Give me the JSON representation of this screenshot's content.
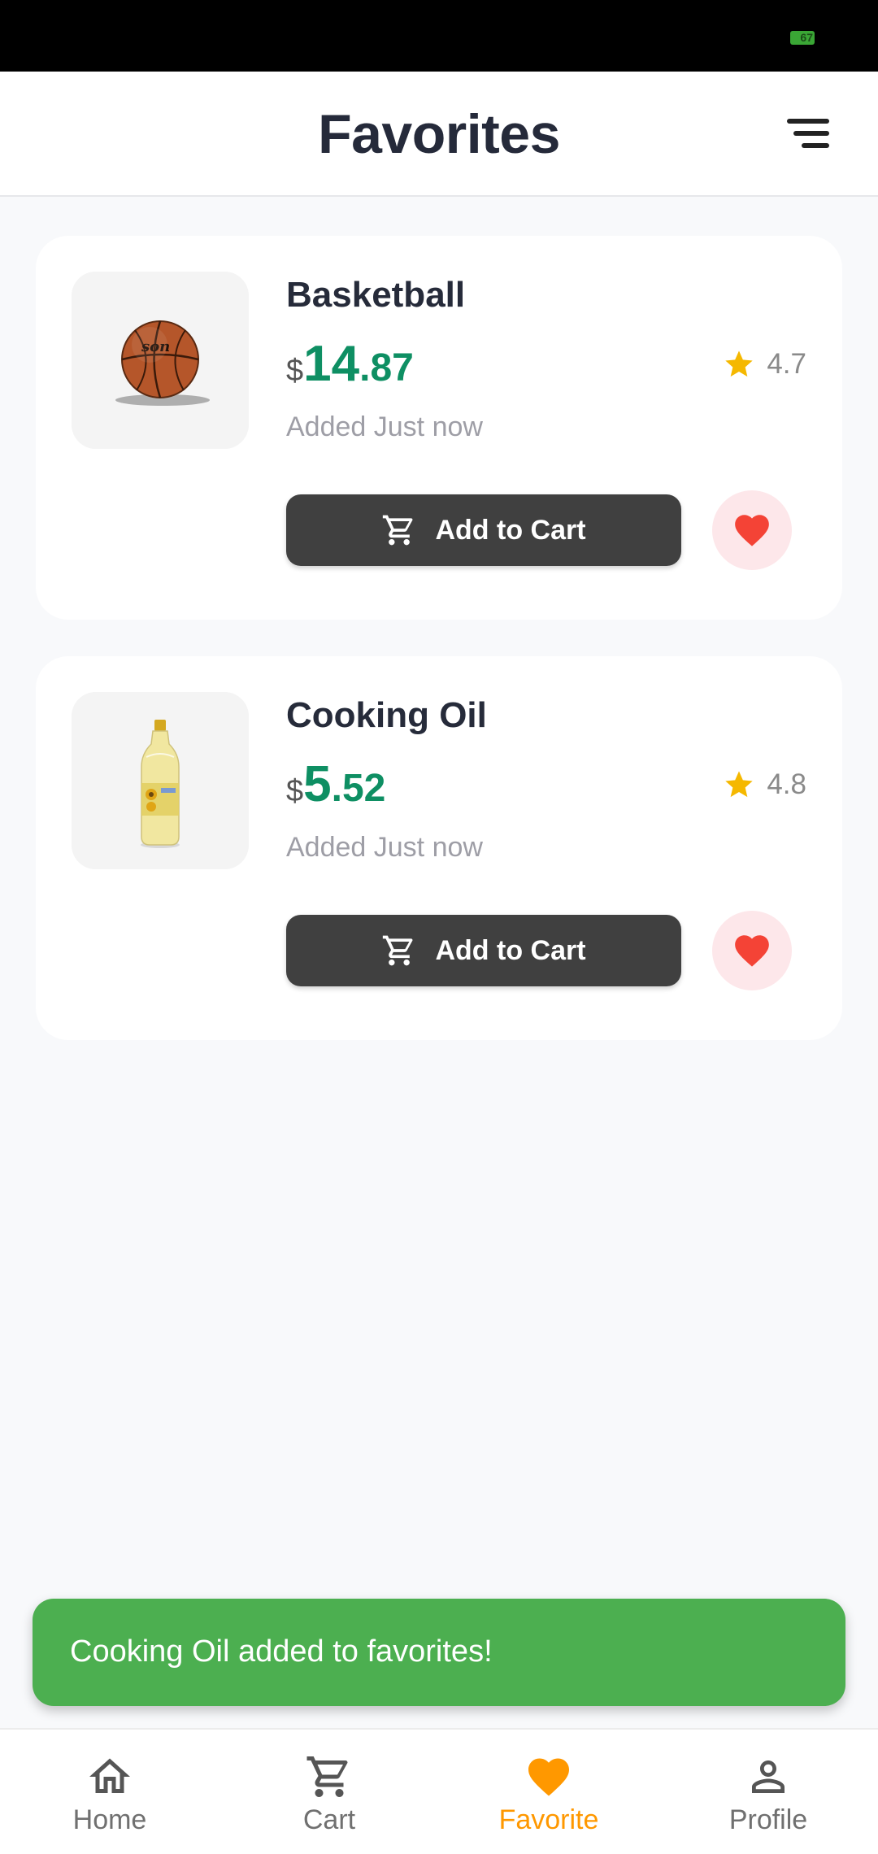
{
  "status_bar": {
    "battery": "67"
  },
  "header": {
    "title": "Favorites"
  },
  "favorites": [
    {
      "name": "Basketball",
      "currency": "$",
      "price_whole": "14",
      "price_frac": ".87",
      "rating": "4.7",
      "added": "Added Just now",
      "cart_label": "Add to Cart"
    },
    {
      "name": "Cooking Oil",
      "currency": "$",
      "price_whole": "5",
      "price_frac": ".52",
      "rating": "4.8",
      "added": "Added Just now",
      "cart_label": "Add to Cart"
    }
  ],
  "snackbar": {
    "message": "Cooking Oil added to favorites!"
  },
  "nav": {
    "items": [
      {
        "label": "Home",
        "icon": "home-icon"
      },
      {
        "label": "Cart",
        "icon": "cart-icon"
      },
      {
        "label": "Favorite",
        "icon": "heart-icon",
        "active": true
      },
      {
        "label": "Profile",
        "icon": "person-icon"
      }
    ]
  },
  "colors": {
    "price": "#0e8f63",
    "accent": "#ff9800",
    "heart": "#f44336",
    "snackbar": "#4caf50",
    "button": "#404040",
    "star": "#f5b800"
  }
}
